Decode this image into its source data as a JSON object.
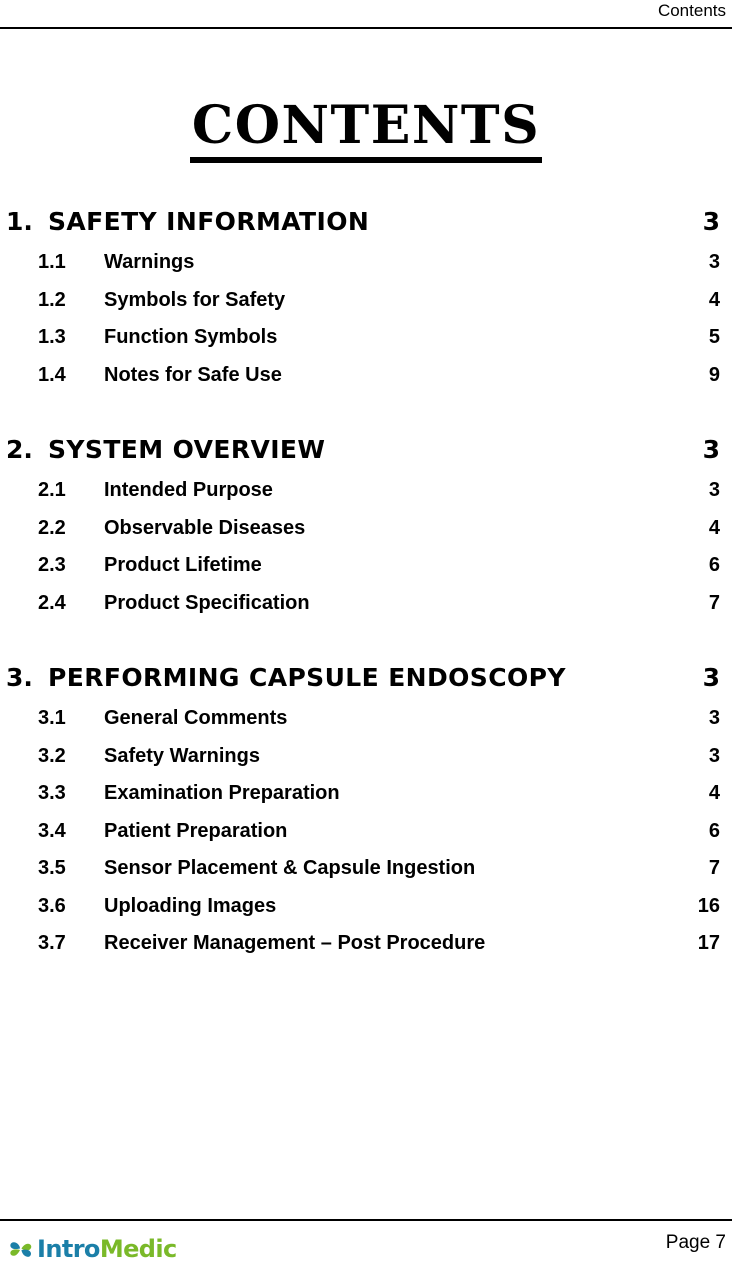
{
  "header": {
    "label": "Contents"
  },
  "title": "CONTENTS",
  "toc": {
    "sections": [
      {
        "num": "1.",
        "label": "SAFETY INFORMATION",
        "page": "3",
        "entries": [
          {
            "num": "1.1",
            "label": "Warnings",
            "page": "3"
          },
          {
            "num": "1.2",
            "label": "Symbols for Safety",
            "page": "4"
          },
          {
            "num": "1.3",
            "label": "Function Symbols",
            "page": "5"
          },
          {
            "num": "1.4",
            "label": "Notes for Safe Use",
            "page": "9"
          }
        ]
      },
      {
        "num": "2.",
        "label": "SYSTEM OVERVIEW",
        "page": "3",
        "entries": [
          {
            "num": "2.1",
            "label": "Intended Purpose",
            "page": "3"
          },
          {
            "num": "2.2",
            "label": "Observable Diseases",
            "page": "4"
          },
          {
            "num": "2.3",
            "label": "Product Lifetime",
            "page": "6"
          },
          {
            "num": "2.4",
            "label": "Product Specification",
            "page": "7"
          }
        ]
      },
      {
        "num": "3.",
        "label": "PERFORMING CAPSULE ENDOSCOPY",
        "page": "3",
        "entries": [
          {
            "num": "3.1",
            "label": "General Comments",
            "page": "3"
          },
          {
            "num": "3.2",
            "label": "Safety Warnings",
            "page": "3"
          },
          {
            "num": "3.3",
            "label": "Examination Preparation",
            "page": "4"
          },
          {
            "num": "3.4",
            "label": "Patient Preparation",
            "page": "6"
          },
          {
            "num": "3.5",
            "label": "Sensor Placement & Capsule Ingestion",
            "page": "7"
          },
          {
            "num": "3.6",
            "label": "Uploading Images",
            "page": "16"
          },
          {
            "num": "3.7",
            "label": "Receiver Management – Post Procedure",
            "page": "17"
          }
        ]
      }
    ]
  },
  "footer": {
    "logo": {
      "mark": "clover-icon",
      "text_primary": "Intro",
      "text_secondary": "Medic",
      "color_primary": "#1b7fa8",
      "color_secondary": "#7ab929"
    },
    "page_number": "Page 7"
  }
}
